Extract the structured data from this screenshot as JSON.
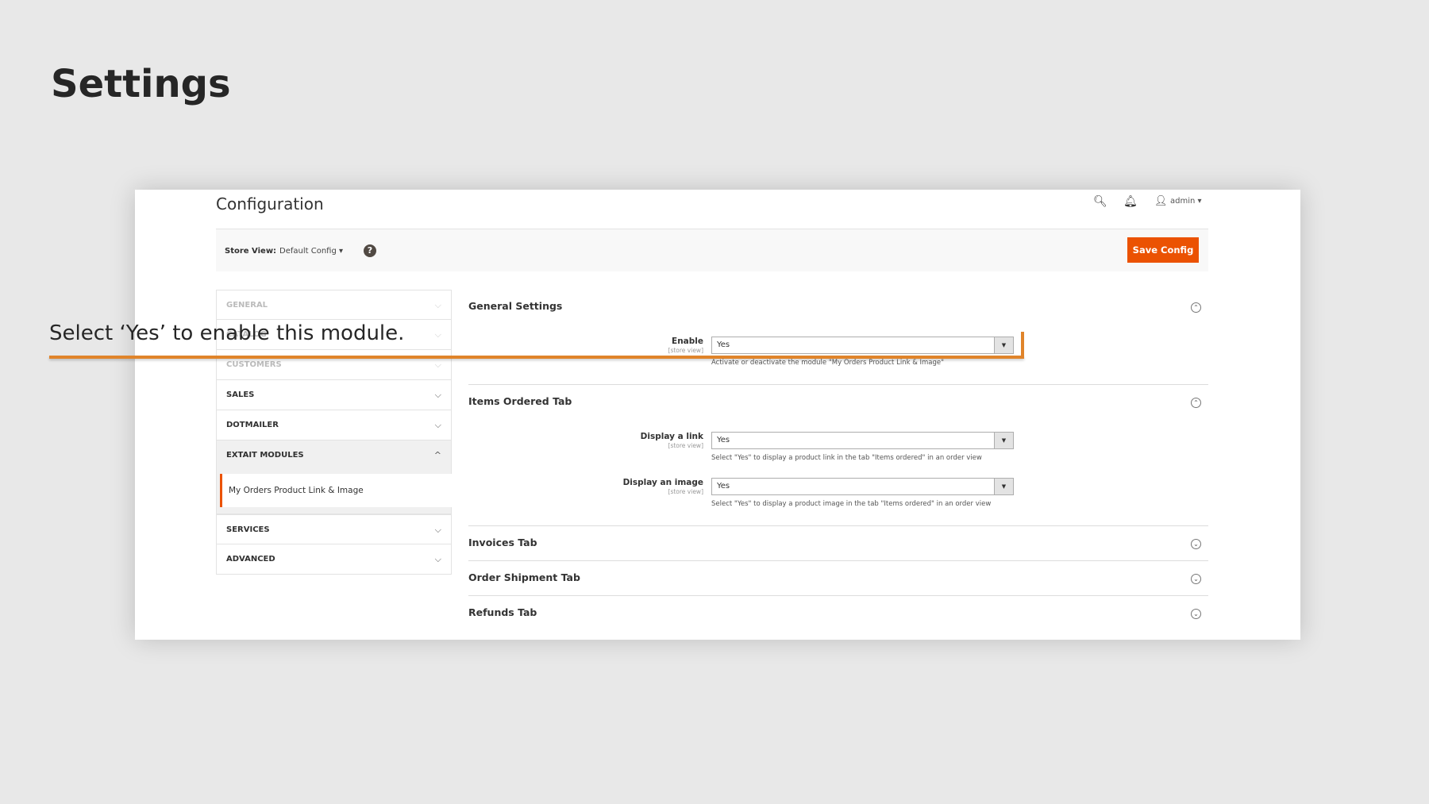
{
  "slide": {
    "title": "Settings",
    "annotation": "Select ‘Yes’ to enable this module.",
    "accent": "#e0842a"
  },
  "header": {
    "title": "Configuration",
    "user": "admin",
    "icons": [
      "search-icon",
      "bell-icon",
      "user-icon"
    ]
  },
  "toolbar": {
    "store_view_label": "Store View:",
    "store_view_value": "Default Config",
    "save_label": "Save Config",
    "save_color": "#eb5202"
  },
  "sidebar": {
    "items": [
      {
        "label": "GENERAL"
      },
      {
        "label": "CATALOG"
      },
      {
        "label": "CUSTOMERS"
      },
      {
        "label": "SALES"
      },
      {
        "label": "DOTMAILER"
      },
      {
        "label": "EXTAIT MODULES"
      },
      {
        "label": "SERVICES"
      },
      {
        "label": "ADVANCED"
      }
    ],
    "sub_item": "My Orders Product Link & Image"
  },
  "sections": {
    "general": {
      "title": "General Settings",
      "enable_label": "Enable",
      "scope": "[store view]",
      "enable_value": "Yes",
      "enable_note": "Activate or deactivate the module \"My Orders Product Link & Image\""
    },
    "items": {
      "title": "Items Ordered Tab",
      "link_label": "Display a link",
      "scope": "[store view]",
      "link_value": "Yes",
      "link_note": "Select \"Yes\" to display a product link in the tab \"Items ordered\" in an order view",
      "image_label": "Display an image",
      "image_value": "Yes",
      "image_note": "Select \"Yes\" to display a product image in the tab \"Items ordered\" in an order view"
    },
    "invoices": {
      "title": "Invoices Tab"
    },
    "shipment": {
      "title": "Order Shipment Tab"
    },
    "refunds": {
      "title": "Refunds Tab"
    }
  }
}
